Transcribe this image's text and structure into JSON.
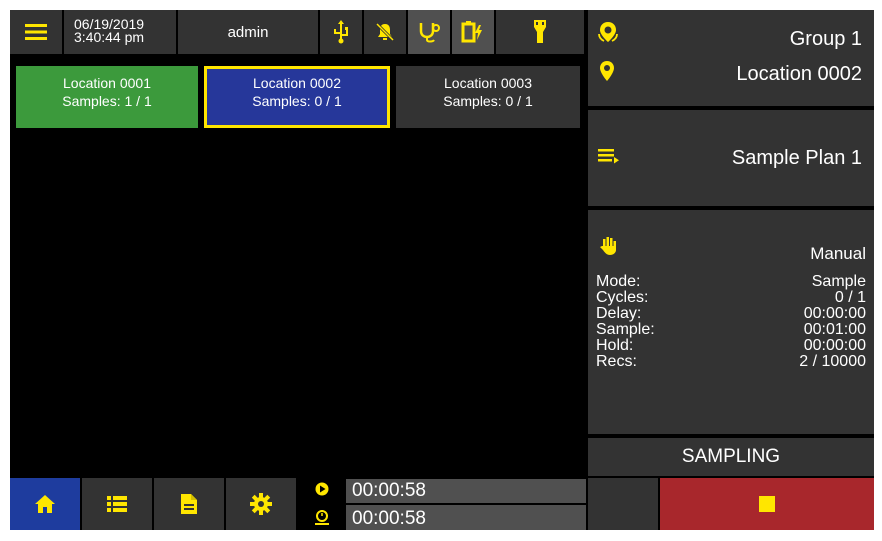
{
  "header": {
    "date": "06/19/2019",
    "time": "3:40:44 pm",
    "user": "admin",
    "icons": [
      "menu-icon",
      "usb-icon",
      "alarm-off-icon",
      "probe-icon",
      "battery-charging-icon",
      "flashlight-icon"
    ]
  },
  "locations": [
    {
      "name": "Location 0001",
      "samples": "Samples: 1 / 1",
      "state": "complete",
      "color": "#3C9A3C"
    },
    {
      "name": "Location 0002",
      "samples": "Samples: 0 / 1",
      "state": "active",
      "color": "#26379A"
    },
    {
      "name": "Location 0003",
      "samples": "Samples: 0 / 1",
      "state": "pending",
      "color": "#333333"
    }
  ],
  "right_panel": {
    "group": "Group 1",
    "location": "Location 0002",
    "sample_plan": "Sample Plan 1",
    "mode_type": "Manual",
    "stats": [
      {
        "label": "Mode:",
        "value": "Sample"
      },
      {
        "label": "Cycles:",
        "value": "0 / 1"
      },
      {
        "label": "Delay:",
        "value": "00:00:00"
      },
      {
        "label": "Sample:",
        "value": "00:01:00"
      },
      {
        "label": "Hold:",
        "value": "00:00:00"
      },
      {
        "label": "Recs:",
        "value": "2 / 10000"
      }
    ],
    "status": "SAMPLING"
  },
  "bottom": {
    "nav_icons": [
      "home-icon",
      "list-icon",
      "document-icon",
      "settings-icon"
    ],
    "elapsed_time": "00:00:58",
    "remaining_time": "00:00:58",
    "elapsed_progress": 0.0,
    "remaining_progress": 0.0
  },
  "colors": {
    "accent": "#FFE600",
    "panel": "#333333",
    "active_border": "#FFE600",
    "stop_button": "#A8272C",
    "home_button": "#1E3C9E"
  }
}
